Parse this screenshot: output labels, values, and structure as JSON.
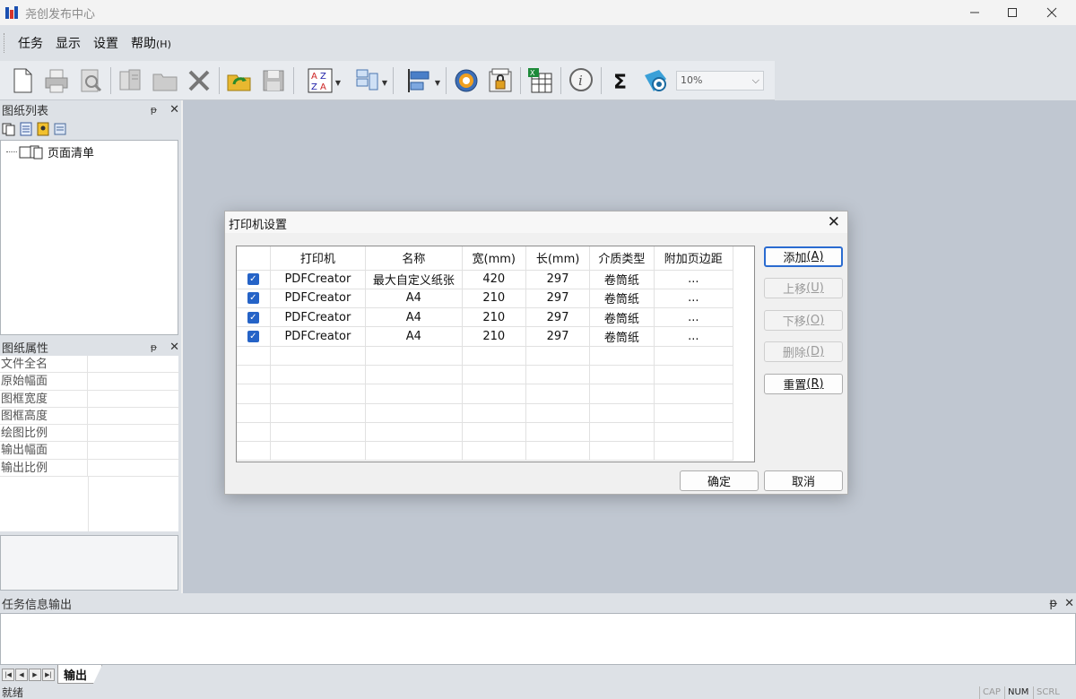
{
  "app": {
    "title": "尧创发布中心"
  },
  "menu": {
    "items": [
      {
        "label": "任务",
        "hotkey": ""
      },
      {
        "label": "显示",
        "hotkey": ""
      },
      {
        "label": "设置",
        "hotkey": ""
      },
      {
        "label": "帮助",
        "hotkey": "(H)"
      }
    ]
  },
  "toolbar": {
    "zoom_value": "10%"
  },
  "tree_panel": {
    "title": "图纸列表",
    "root_node": "页面清单"
  },
  "props_panel": {
    "title": "图纸属性",
    "rows": [
      "文件全名",
      "原始幅面",
      "图框宽度",
      "图框高度",
      "绘图比例",
      "输出幅面",
      "输出比例"
    ]
  },
  "output_panel": {
    "title": "任务信息输出",
    "tab": "输出"
  },
  "status": {
    "text": "就绪",
    "cap": "CAP",
    "num": "NUM",
    "scrl": "SCRL"
  },
  "dialog": {
    "title": "打印机设置",
    "columns": [
      "打印机",
      "名称",
      "宽(mm)",
      "长(mm)",
      "介质类型",
      "附加页边距"
    ],
    "rows": [
      {
        "checked": true,
        "printer": "PDFCreator",
        "name": "最大自定义纸张",
        "width": "420",
        "length": "297",
        "media": "卷筒纸",
        "margin": "..."
      },
      {
        "checked": true,
        "printer": "PDFCreator",
        "name": "A4",
        "width": "210",
        "length": "297",
        "media": "卷筒纸",
        "margin": "..."
      },
      {
        "checked": true,
        "printer": "PDFCreator",
        "name": "A4",
        "width": "210",
        "length": "297",
        "media": "卷筒纸",
        "margin": "..."
      },
      {
        "checked": true,
        "printer": "PDFCreator",
        "name": "A4",
        "width": "210",
        "length": "297",
        "media": "卷筒纸",
        "margin": "..."
      }
    ],
    "buttons": {
      "add": {
        "label": "添加",
        "key": "(A)"
      },
      "up": {
        "label": "上移",
        "key": "(U)"
      },
      "down": {
        "label": "下移",
        "key": "(O)"
      },
      "delete": {
        "label": "删除",
        "key": "(D)"
      },
      "reset": {
        "label": "重置",
        "key": "(R)"
      },
      "ok": "确定",
      "cancel": "取消"
    }
  }
}
